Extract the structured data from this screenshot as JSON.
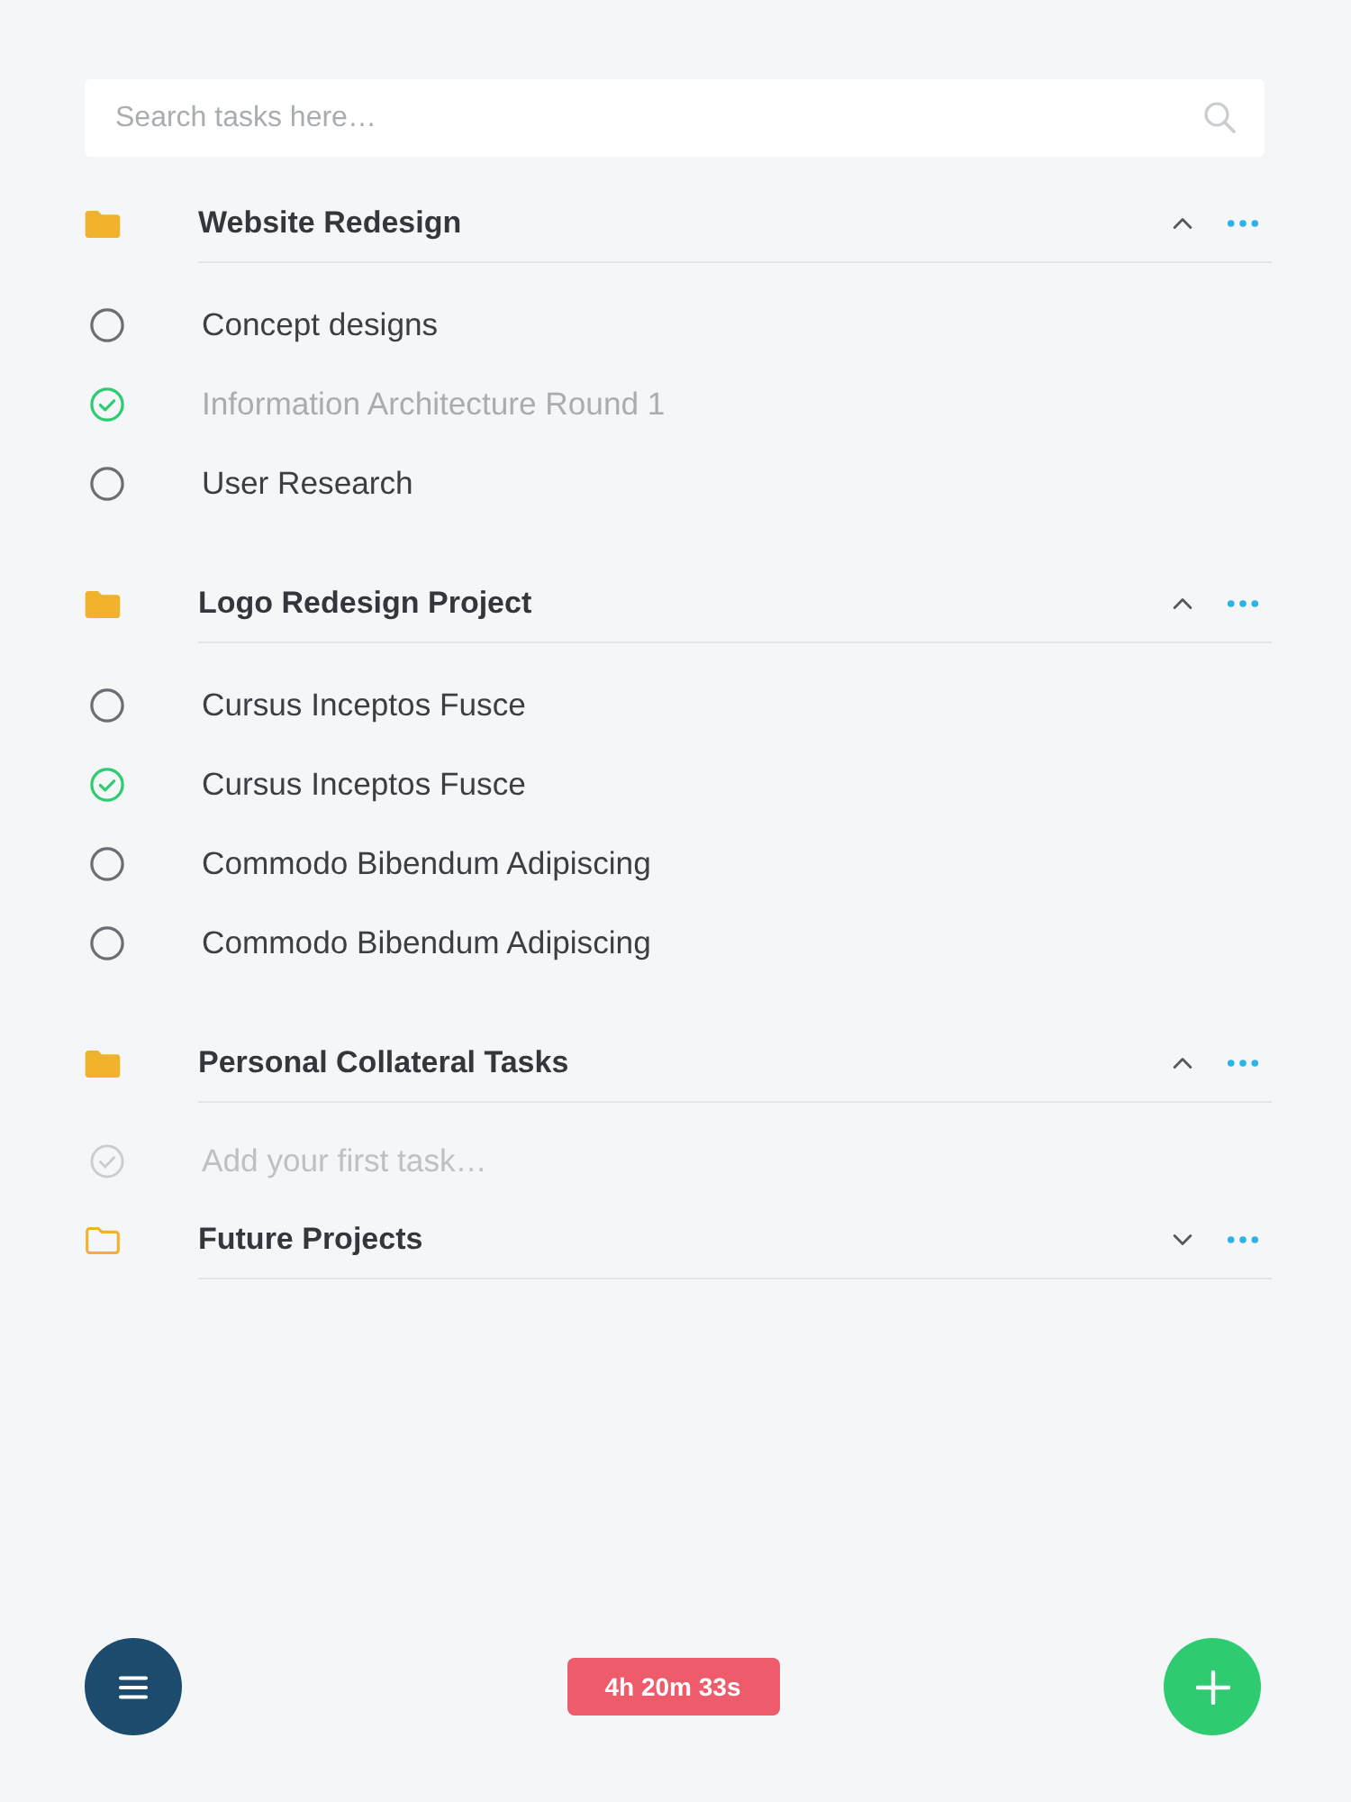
{
  "search": {
    "placeholder": "Search tasks here…"
  },
  "projects": [
    {
      "title": "Website Redesign",
      "expanded": true,
      "tasks": [
        {
          "label": "Concept designs",
          "done": false,
          "dimmed": false
        },
        {
          "label": "Information Architecture Round 1",
          "done": true,
          "dimmed": true
        },
        {
          "label": "User Research",
          "done": false,
          "dimmed": false
        }
      ]
    },
    {
      "title": "Logo Redesign Project",
      "expanded": true,
      "tasks": [
        {
          "label": "Cursus Inceptos Fusce",
          "done": false,
          "dimmed": false
        },
        {
          "label": "Cursus Inceptos Fusce",
          "done": true,
          "dimmed": false
        },
        {
          "label": "Commodo Bibendum Adipiscing",
          "done": false,
          "dimmed": false
        },
        {
          "label": "Commodo Bibendum Adipiscing",
          "done": false,
          "dimmed": false
        }
      ]
    },
    {
      "title": "Personal Collateral Tasks",
      "expanded": true,
      "new_task": {
        "placeholder": "Add your first task…"
      }
    },
    {
      "title": "Future Projects",
      "expanded": false
    }
  ],
  "timer": "4h 20m 33s"
}
